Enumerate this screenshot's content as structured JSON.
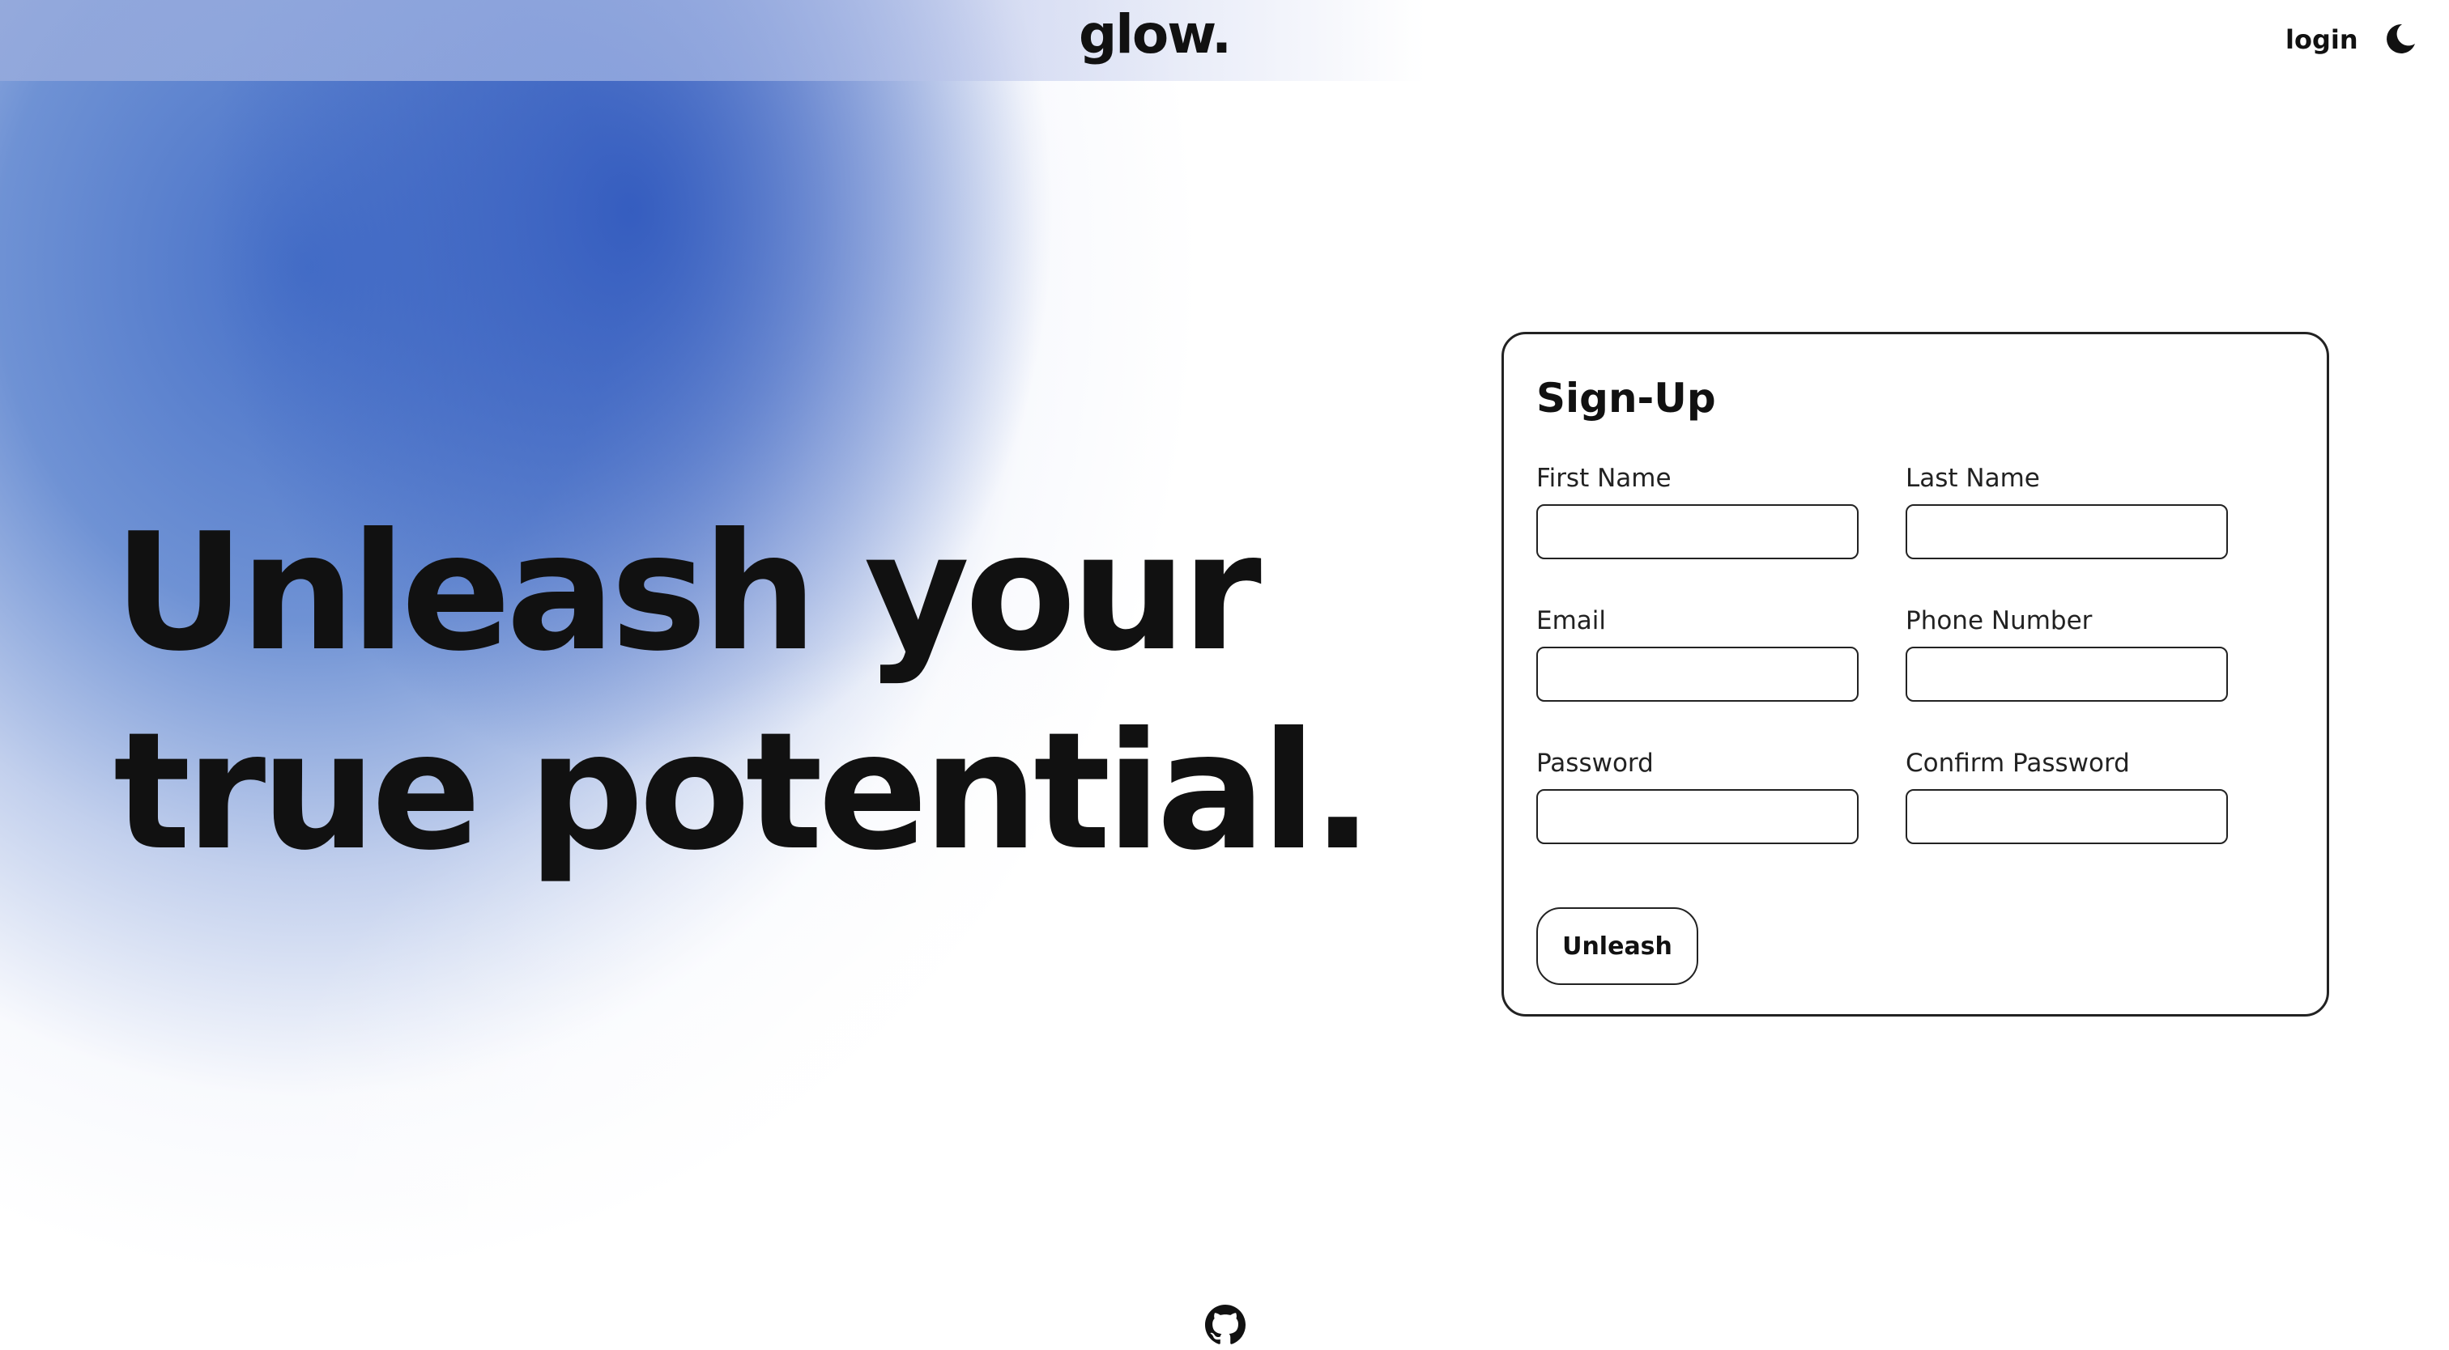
{
  "header": {
    "brand": "glow.",
    "login_label": "login",
    "theme_icon": "moon-icon"
  },
  "hero": {
    "line1": "Unleash your",
    "line2": "true potential."
  },
  "signup_form": {
    "title": "Sign-Up",
    "fields": [
      {
        "label": "First Name",
        "value": ""
      },
      {
        "label": "Last Name",
        "value": ""
      },
      {
        "label": "Email",
        "value": ""
      },
      {
        "label": "Phone Number",
        "value": ""
      },
      {
        "label": "Password",
        "value": ""
      },
      {
        "label": "Confirm Password",
        "value": ""
      }
    ],
    "submit_label": "Unleash"
  },
  "footer": {
    "icon": "github-icon"
  },
  "colors": {
    "glow_blue": "#3a62c0",
    "text": "#111111",
    "border": "#222222",
    "background": "#ffffff"
  }
}
